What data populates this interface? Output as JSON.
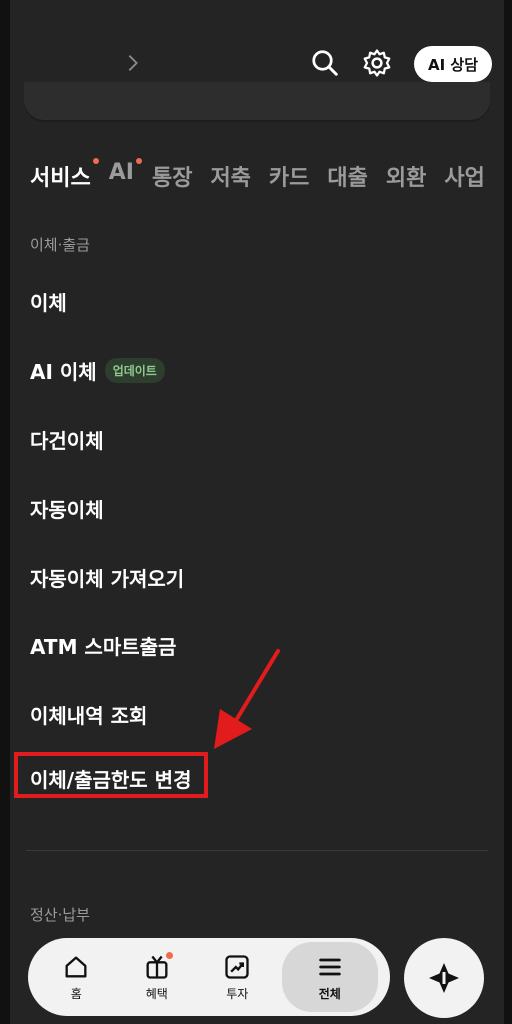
{
  "header": {
    "ai_button_label": "AI 상담"
  },
  "tabs": [
    {
      "label": "서비스",
      "has_dot": true
    },
    {
      "label": "AI",
      "has_dot": true
    },
    {
      "label": "통장",
      "has_dot": false
    },
    {
      "label": "저축",
      "has_dot": false
    },
    {
      "label": "카드",
      "has_dot": false
    },
    {
      "label": "대출",
      "has_dot": false
    },
    {
      "label": "외환",
      "has_dot": false
    },
    {
      "label": "사업",
      "has_dot": false
    }
  ],
  "sections": [
    {
      "title": "이체·출금",
      "items": [
        {
          "label": "이체"
        },
        {
          "label": "AI 이체",
          "badge": "업데이트"
        },
        {
          "label": "다건이체"
        },
        {
          "label": "자동이체"
        },
        {
          "label": "자동이체 가져오기"
        },
        {
          "label": "ATM 스마트출금"
        },
        {
          "label": "이체내역 조회"
        },
        {
          "label": "이체/출금한도 변경"
        }
      ]
    },
    {
      "title": "정산·납부",
      "items": []
    }
  ],
  "bottom_nav": [
    {
      "label": "홈",
      "icon": "home-icon"
    },
    {
      "label": "혜택",
      "icon": "tv-gift-icon",
      "has_dot": true
    },
    {
      "label": "투자",
      "icon": "chart-up-icon"
    },
    {
      "label": "전체",
      "icon": "menu-icon",
      "active": true
    }
  ],
  "colors": {
    "background": "#242424",
    "accent_dot": "#f06c4b",
    "highlight_box": "#e21c1c",
    "badge_text": "#8fc98f"
  }
}
